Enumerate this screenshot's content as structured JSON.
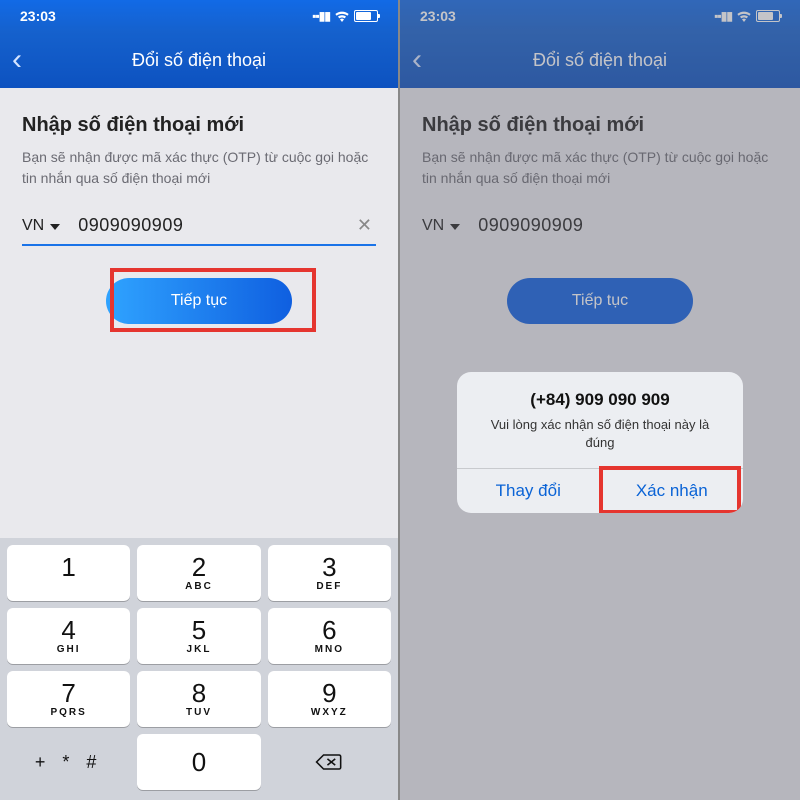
{
  "status": {
    "time": "23:03"
  },
  "nav": {
    "title": "Đổi số điện thoại"
  },
  "page": {
    "heading": "Nhập số điện thoại mới",
    "sub": "Bạn sẽ nhận được mã xác thực (OTP) từ cuộc gọi hoặc tin nhắn qua số điện thoại mới",
    "cc": "VN",
    "phone": "0909090909",
    "cta": "Tiếp tục"
  },
  "alert": {
    "title": "(+84) 909 090 909",
    "message": "Vui lòng xác nhận số điện thoại này là đúng",
    "cancel": "Thay đổi",
    "confirm": "Xác nhận"
  },
  "keypad": {
    "k1": "1",
    "k2": "2",
    "k3": "3",
    "k4": "4",
    "k5": "5",
    "k6": "6",
    "k7": "7",
    "k8": "8",
    "k9": "9",
    "k0": "0",
    "l2": "ABC",
    "l3": "DEF",
    "l4": "GHI",
    "l5": "JKL",
    "l6": "MNO",
    "l7": "PQRS",
    "l8": "TUV",
    "l9": "WXYZ",
    "star": "+ * #"
  }
}
